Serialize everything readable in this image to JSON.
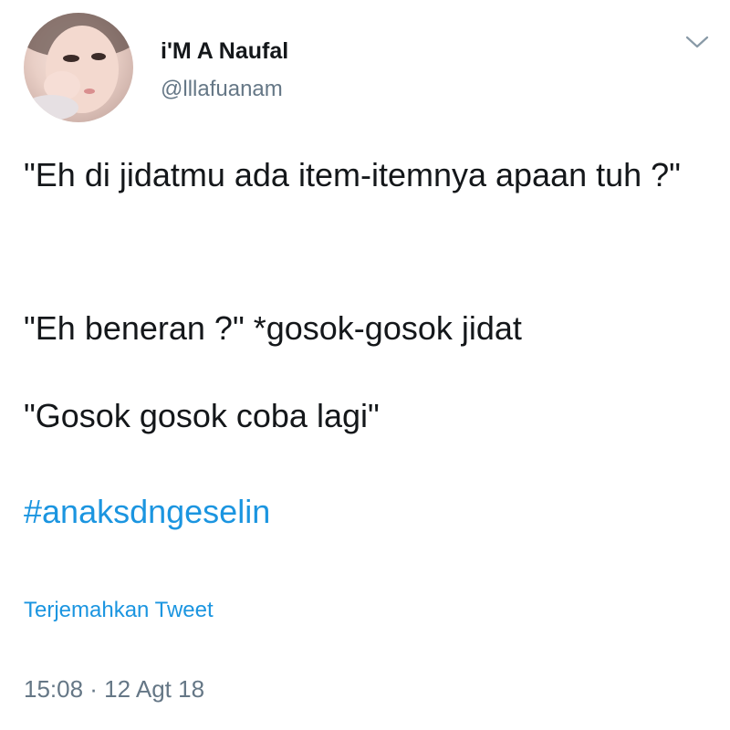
{
  "tweet": {
    "author": {
      "display_name": "i'M A Naufal",
      "handle": "@lllafuanam",
      "avatar_icon": "user-photo-avatar"
    },
    "menu_icon": "chevron-down-icon",
    "text_lines": [
      "\"Eh di jidatmu ada item-itemnya apaan tuh ?\"",
      "\"Eh beneran ?\" *gosok-gosok jidat",
      "\"Gosok gosok coba lagi\""
    ],
    "hashtag": "#anaksdngeselin",
    "translate_label": "Terjemahkan Tweet",
    "timestamp": "15:08 · 12 Agt 18"
  },
  "colors": {
    "text": "#14171a",
    "secondary": "#657786",
    "link": "#1b95e0",
    "background": "#ffffff"
  }
}
